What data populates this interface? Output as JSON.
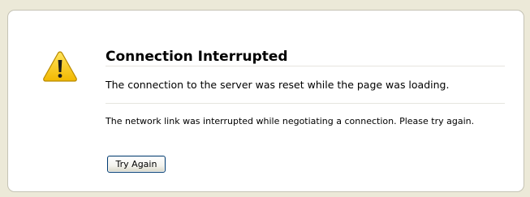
{
  "error_page": {
    "title": "Connection Interrupted",
    "short_description": "The connection to the server was reset while the page was loading.",
    "long_description": "The network link was interrupted while negotiating a connection. Please try again.",
    "try_again_label": "Try Again",
    "icon": "warning-icon"
  },
  "colors": {
    "page_background": "#ECE9D8",
    "box_background": "#FFFFFF",
    "box_border": "#C5C3B5",
    "warning_yellow": "#F5C400",
    "button_border": "#003C74"
  }
}
